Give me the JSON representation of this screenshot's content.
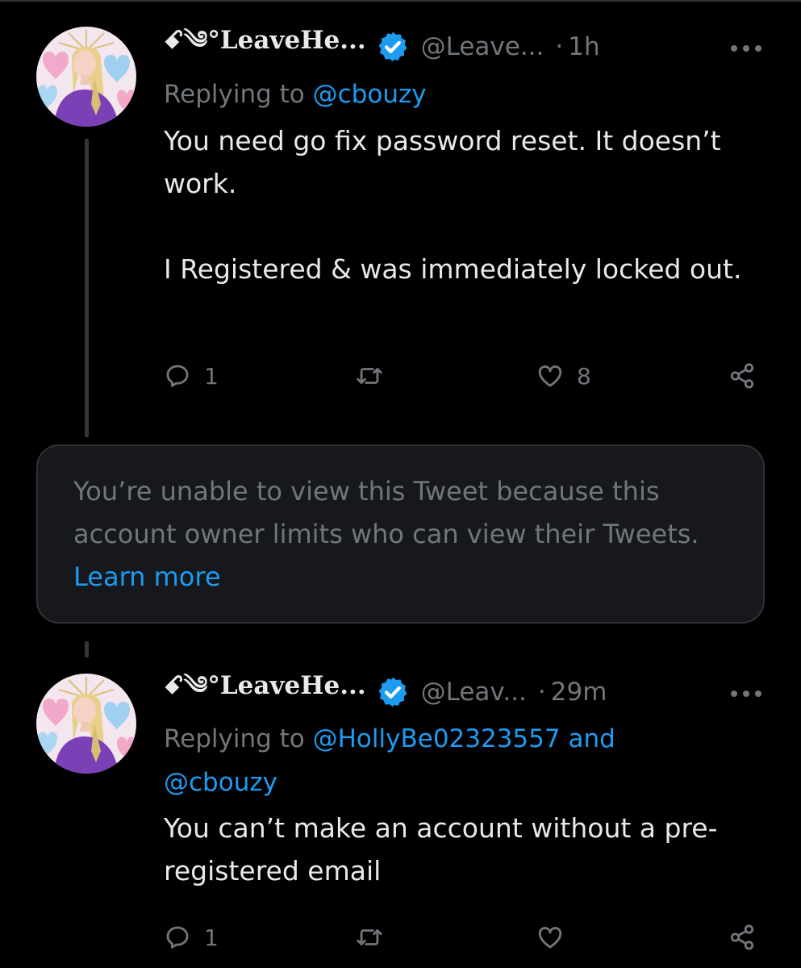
{
  "tweets": [
    {
      "display_name": "ꗃ༄°LeaveHe...",
      "handle": "@Leave...",
      "separator": "·",
      "time": "1h",
      "replying_prefix": "Replying to ",
      "replying_mentions": "@cbouzy",
      "replying_mentions_2": "",
      "body": "You need go fix password reset. It doesn’t work.\n\nI Registered & was immediately locked out.",
      "reply_count": "1",
      "retweet_count": "",
      "like_count": "8"
    },
    {
      "display_name": "ꗃ༄°LeaveHe...",
      "handle": "@Leav...",
      "separator": "·",
      "time": "29m",
      "replying_prefix": "Replying to ",
      "replying_mentions": "@HollyBe02323557 and",
      "replying_mentions_2": "@cbouzy",
      "body": "You can’t make an account without a pre-registered email",
      "reply_count": "1",
      "retweet_count": "",
      "like_count": ""
    }
  ],
  "notice": {
    "text": "You’re unable to view this Tweet because this account owner limits who can view their Tweets. ",
    "link": "Learn more"
  },
  "colors": {
    "background": "#000000",
    "text": "#e7e9ea",
    "muted": "#71767b",
    "link": "#1d9bf0",
    "verified": "#1d9bf0",
    "notice_bg": "#16181c"
  },
  "icons": [
    "verified-badge-icon",
    "more-icon",
    "reply-icon",
    "retweet-icon",
    "like-icon",
    "share-icon"
  ]
}
